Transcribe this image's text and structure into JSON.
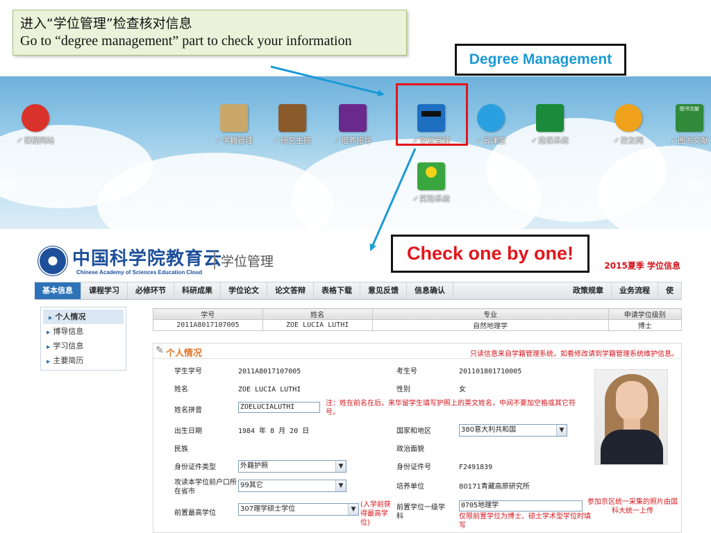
{
  "callout": {
    "zh": "进入“学位管理”检查核对信息",
    "en": "Go to “degree management” part to check your information"
  },
  "labels": {
    "degree_management": "Degree Management",
    "check_one_by_one": "Check one by one!"
  },
  "portal": {
    "nav_left": "«",
    "nav_right": "»",
    "apps": [
      {
        "label": "课程网站",
        "icon": "course-website-icon",
        "color": "#d8322b"
      },
      {
        "label": "学籍管理",
        "icon": "student-status-icon",
        "color": "#c9a86a"
      },
      {
        "label": "研究生院",
        "icon": "graduate-school-icon",
        "color": "#8a5a2b"
      },
      {
        "label": "培养指导",
        "icon": "training-guide-icon",
        "color": "#6a2a8c"
      },
      {
        "label": "学位管理",
        "icon": "degree-management-icon",
        "color": "#1e6fc2"
      },
      {
        "label": "云课堂",
        "icon": "cloud-classroom-icon",
        "color": "#2aa0e0"
      },
      {
        "label": "选课系统",
        "icon": "course-selection-icon",
        "color": "#1b8a3a"
      },
      {
        "label": "校友网",
        "icon": "alumni-network-icon",
        "color": "#f0a21c"
      },
      {
        "label": "图书文献",
        "icon": "library-icon",
        "color": "#2f8a3a"
      },
      {
        "label": "奖助系统",
        "icon": "award-system-icon",
        "color": "#3aa640"
      }
    ],
    "library_tile_text": "图书文献"
  },
  "site": {
    "logo_cn": "中国科学院教育云",
    "logo_en": "Chinese Academy of Sciences Education Cloud",
    "subtitle": "学位管理",
    "season": "2015夏季 学位信息",
    "nav": [
      "基本信息",
      "课程学习",
      "必修环节",
      "科研成果",
      "学位论文",
      "论文答辩",
      "表格下载",
      "意见反馈",
      "信息确认"
    ],
    "nav_right": [
      "政策规章",
      "业务流程",
      "使"
    ],
    "menu": [
      "个人情况",
      "博导信息",
      "学习信息",
      "主要简历"
    ],
    "summary": {
      "headers": [
        "学号",
        "姓名",
        "专业",
        "申请学位级别"
      ],
      "row": [
        "2011A8017107005",
        "ZOE LUCIA LUTHI",
        "自然地理学",
        "博士"
      ]
    },
    "section_title": "个人情况",
    "readonly_note": "只读信息来自学籍管理系统，如看修改请到学籍管理系统维护信息。",
    "fields": {
      "student_no_label": "学生学号",
      "student_no": "2011A8017107005",
      "exam_no_label": "考生号",
      "exam_no": "201101801710005",
      "name_label": "姓名",
      "name": "ZOE LUCIA LUTHI",
      "gender_label": "性别",
      "gender": "女",
      "pinyin_label": "姓名拼音",
      "pinyin": "ZOELUCIALUTHI",
      "pinyin_note": "注：姓在前名在后，来华留学生填写护照上的英文姓名，中间不要加空格或其它符号。",
      "birth_label": "出生日期",
      "birth": "1984 年 8 月 20 日",
      "country_label": "国家和地区",
      "country": "380意大利共和国",
      "ethnic_label": "民族",
      "political_label": "政治面貌",
      "id_type_label": "身份证件类型",
      "id_type": "外籍护照",
      "id_no_label": "身份证件号",
      "id_no": "F2491839",
      "hukou_label": "攻读本学位前户口所在省市",
      "hukou": "99其它",
      "unit_label": "培养单位",
      "unit": "80171青藏高原研究所",
      "prev_degree_label": "前置最高学位",
      "prev_degree": "307理学硕士学位",
      "prev_degree_note": "(入学前获得最高学位)",
      "prev_discipline_label": "前置学位一级学科",
      "prev_discipline": "0705地理学",
      "prev_discipline_note": "仅限前置学位为博士、硕士学术型学位时填写",
      "photo_note": "参加京区统一采集的照片由国科大统一上传"
    }
  }
}
